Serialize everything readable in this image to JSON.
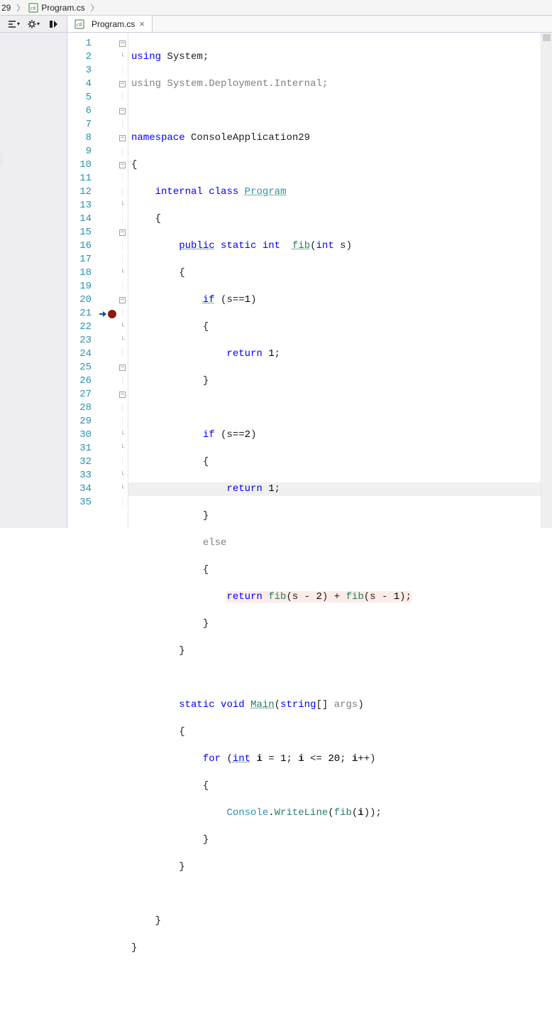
{
  "breadcrumb": {
    "project": "29",
    "file": "Program.cs"
  },
  "tab": {
    "file": "Program.cs"
  },
  "code": {
    "l1": "using System;",
    "l2": "using System.Deployment.Internal;",
    "l3": "",
    "l4": "namespace ConsoleApplication29",
    "l5": "{",
    "l6": "    internal class Program",
    "l7": "    {",
    "l8": "        public static int  fib(int s)",
    "l9": "        {",
    "l10": "            if (s==1)",
    "l11": "            {",
    "l12": "                return 1;",
    "l13": "            }",
    "l14": "",
    "l15": "            if (s==2)",
    "l16": "            {",
    "l17": "                return 1;",
    "l18": "            }",
    "l19": "            else",
    "l20": "            {",
    "l21": "                return fib(s - 2) + fib(s - 1);",
    "l22": "            }",
    "l23": "        }",
    "l24": "",
    "l25": "        static void Main(string[] args)",
    "l26": "        {",
    "l27": "            for (int i = 1; i <= 20; i++)",
    "l28": "            {",
    "l29": "                Console.WriteLine(fib(i));",
    "l30": "            }",
    "l31": "        }",
    "l32": "",
    "l33": "    }",
    "l34": "}"
  },
  "line_numbers": [
    "1",
    "2",
    "3",
    "4",
    "5",
    "6",
    "7",
    "8",
    "9",
    "10",
    "11",
    "12",
    "13",
    "14",
    "15",
    "16",
    "17",
    "18",
    "19",
    "20",
    "21",
    "22",
    "23",
    "24",
    "25",
    "26",
    "27",
    "28",
    "29",
    "30",
    "31",
    "32",
    "33",
    "34",
    "35"
  ],
  "breakpoint_line": 21,
  "tokens": {
    "using": "using",
    "System": "System",
    "Deployment": "Deployment",
    "Internal": "Internal",
    "namespace": "namespace",
    "ConsoleApplication29": "ConsoleApplication29",
    "internal": "internal",
    "class": "class",
    "Program": "Program",
    "public": "public",
    "static": "static",
    "int": "int",
    "fib": "fib",
    "s": "s",
    "if": "if",
    "return": "return",
    "else": "else",
    "void": "void",
    "Main": "Main",
    "string": "string",
    "args": "args",
    "for": "for",
    "i": "i",
    "Console": "Console",
    "WriteLine": "WriteLine",
    "one": "1",
    "two": "2",
    "twenty": "20"
  }
}
